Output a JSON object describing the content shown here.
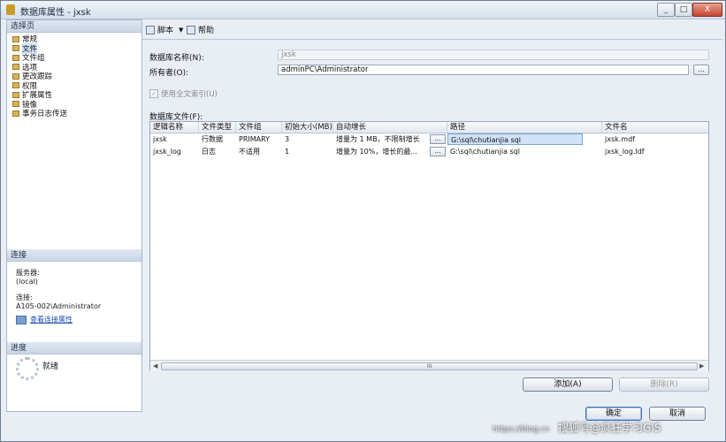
{
  "window": {
    "title": "数据库属性 - jxsk",
    "minimize": "_",
    "maximize": "□",
    "close": "X"
  },
  "left": {
    "pages_header": "选择页",
    "pages": [
      "常规",
      "文件",
      "文件组",
      "选项",
      "更改跟踪",
      "权限",
      "扩展属性",
      "镜像",
      "事务日志传送"
    ],
    "connection_header": "连接",
    "server_label": "服务器:",
    "server_value": "(local)",
    "connection_label": "连接:",
    "connection_value": "A105-002\\Administrator",
    "view_conn_link": "查看连接属性",
    "progress_header": "进度",
    "status": "就绪"
  },
  "toolbar": {
    "script_label": "脚本",
    "help_label": "帮助"
  },
  "form": {
    "dbname_label": "数据库名称(N):",
    "dbname_value": "jxsk",
    "owner_label": "所有者(O):",
    "owner_value": "adminPC\\Administrator",
    "browse": "...",
    "fulltext_label": "使用全文索引(U)",
    "files_label": "数据库文件(F):"
  },
  "grid": {
    "columns": [
      "逻辑名称",
      "文件类型",
      "文件组",
      "初始大小(MB)",
      "自动增长",
      "路径",
      "文件名"
    ],
    "rows": [
      {
        "logical": "jxsk",
        "type": "行数据",
        "group": "PRIMARY",
        "size": "3",
        "growth": "增量为 1 MB，不限制增长",
        "path": "G:\\sql\\chutianjia sql",
        "file": "jxsk.mdf"
      },
      {
        "logical": "jxsk_log",
        "type": "日志",
        "group": "不适用",
        "size": "1",
        "growth": "增量为 10%，增长的最...",
        "path": "G:\\sql\\chutianjia sql",
        "file": "jxsk_log.ldf"
      }
    ],
    "cell_btn": "...",
    "scroll_thumb": "III"
  },
  "buttons": {
    "add": "添加(A)",
    "remove": "删除(R)",
    "ok": "确定",
    "cancel": "取消"
  },
  "watermark": {
    "url": "https://blog.cs",
    "brand": "搜狐号@疯狂学习GIS"
  }
}
